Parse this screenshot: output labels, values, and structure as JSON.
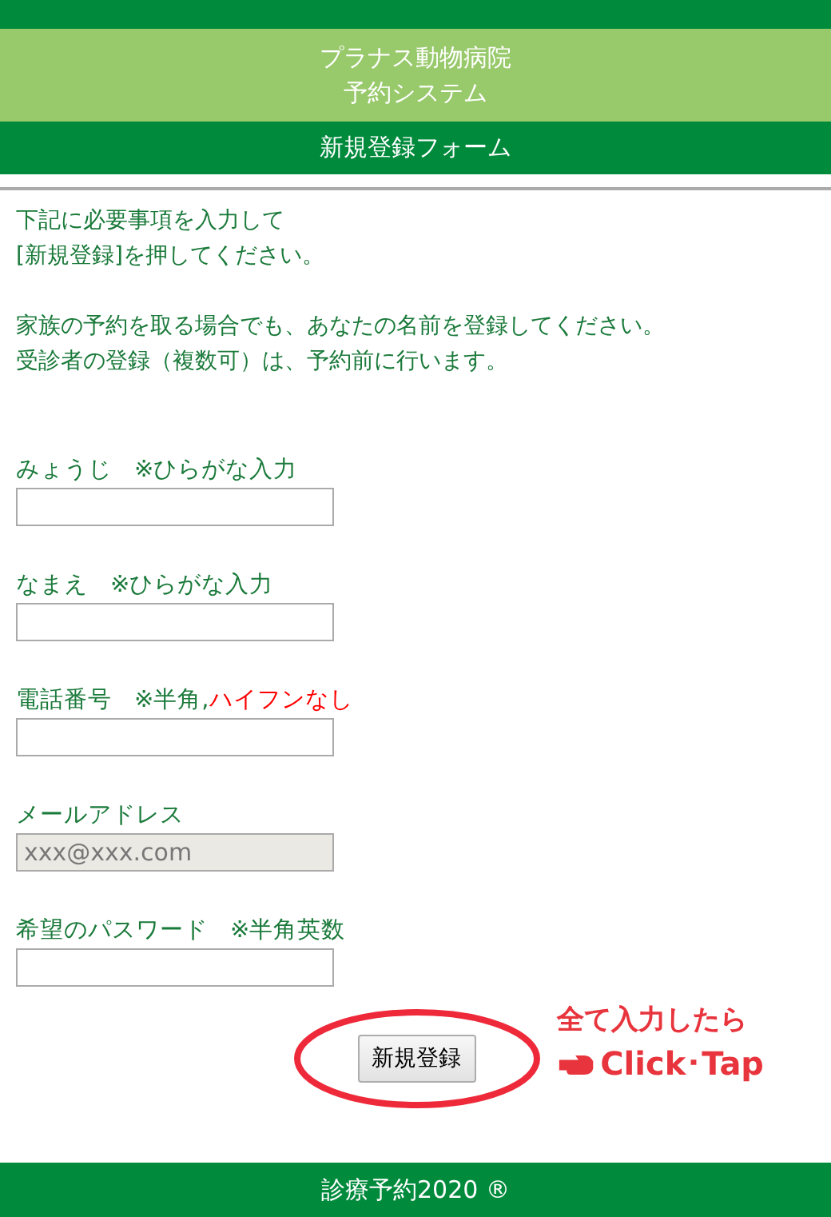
{
  "header": {
    "clinic_name": "プラナス動物病院",
    "system_name": "予約システム",
    "form_title": "新規登録フォーム"
  },
  "intro": [
    "下記に必要事項を入力して",
    "[新規登録]を押してください。",
    "家族の予約を取る場合でも、あなたの名前を登録してください。",
    "受診者の登録（複数可）は、予約前に行います。"
  ],
  "fields": [
    {
      "label": "みょうじ",
      "hint": "※ひらがな入力",
      "disabled": false
    },
    {
      "label": "なまえ",
      "hint": "※ひらがな入力",
      "disabled": false
    },
    {
      "label": "電話番号",
      "hint": "※半角,",
      "warning": "ハイフンなし",
      "disabled": false
    },
    {
      "label": "メールアドレス",
      "placeholder": "xxx@xxx.com",
      "disabled": true
    },
    {
      "label": "希望のパスワード",
      "hint": "※半角英数",
      "disabled": false
    }
  ],
  "submit_button": "新規登録",
  "annotation": {
    "line1": "全て入力したら",
    "line2": "Click･Tap"
  },
  "footer": "診療予約2020 ®"
}
